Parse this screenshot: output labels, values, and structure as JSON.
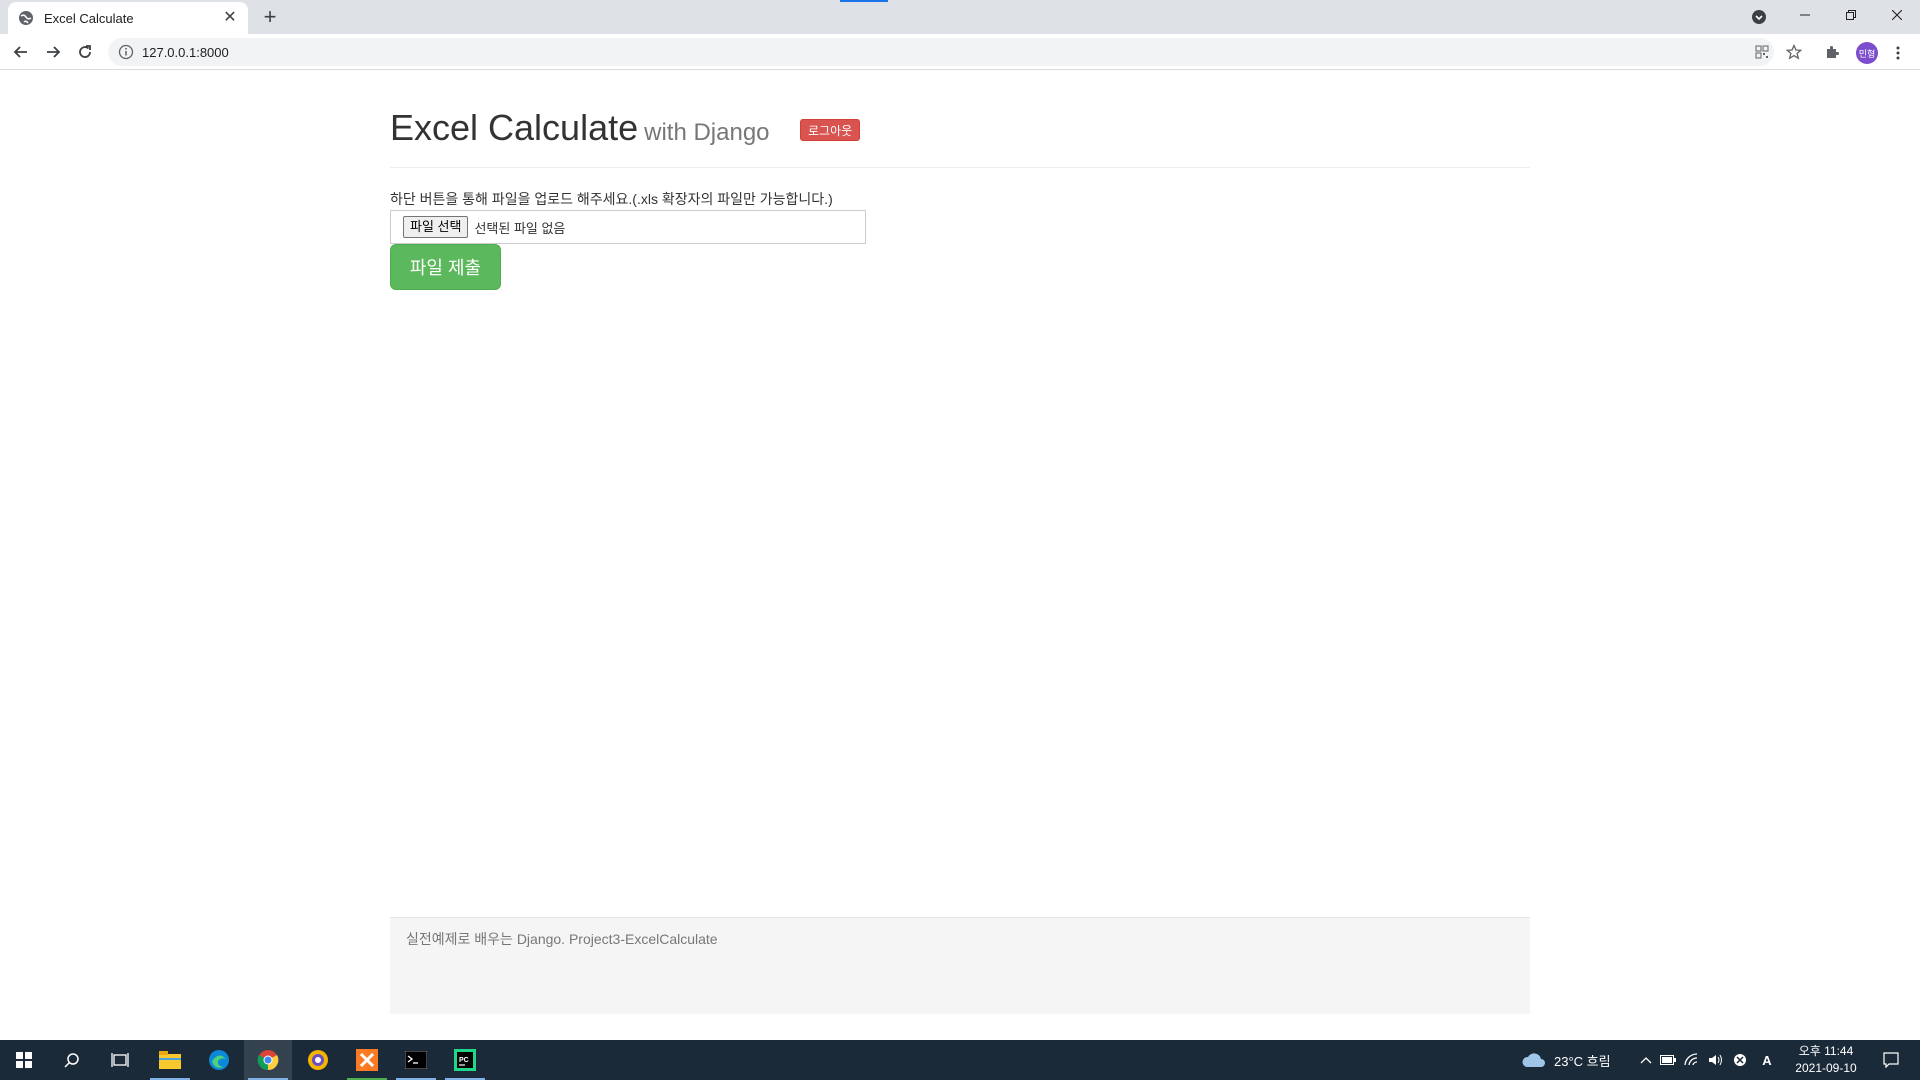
{
  "browser": {
    "tab_title": "Excel Calculate",
    "new_tab_label": "+",
    "url": "127.0.0.1:8000",
    "profile_initials": "민형"
  },
  "page": {
    "title": "Excel Calculate",
    "subtitle": "with Django",
    "logout_label": "로그아웃",
    "instruction": "하단 버튼을 통해 파일을 업로드 해주세요.(.xls 확장자의 파일만 가능합니다.)",
    "file_button_label": "파일 선택",
    "file_status": "선택된 파일 없음",
    "submit_label": "파일 제출",
    "footer_text": "실전예제로 배우는 Django. Project3-ExcelCalculate"
  },
  "taskbar": {
    "weather": "23°C  흐림",
    "ime_label": "A",
    "time": "오후 11:44",
    "date": "2021-09-10"
  },
  "colors": {
    "accent": "#1a73e8",
    "logout": "#d9534f",
    "submit": "#5cb85c",
    "taskbar": "#1b2a39"
  }
}
